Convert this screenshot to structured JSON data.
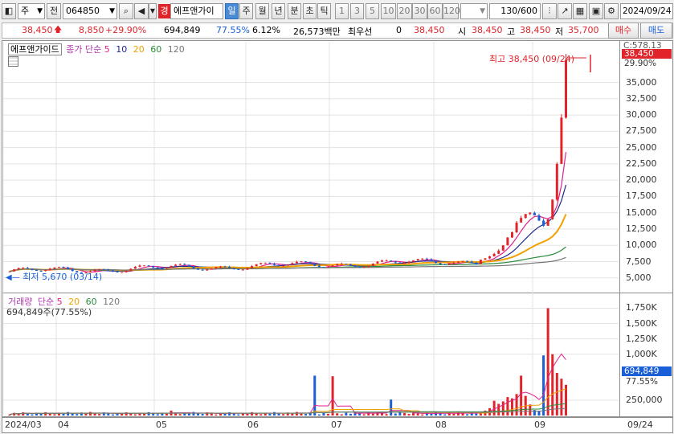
{
  "toolbar": {
    "market": "주",
    "series": "전",
    "code": "064850",
    "badge": "경",
    "name": "에프앤가이",
    "periods": [
      "일",
      "주",
      "월",
      "년",
      "분",
      "초",
      "틱"
    ],
    "active_period": "일",
    "intervals": [
      "1",
      "3",
      "5",
      "10",
      "20",
      "30",
      "60",
      "120"
    ],
    "count": "130",
    "count_total": "/600",
    "date": "2024/09/24"
  },
  "quote": {
    "price": "38,450",
    "arrow": "🡅",
    "change": "8,850",
    "change_pct": "+29.90%",
    "volume": "694,849",
    "turnover_pct": "77.55%",
    "ratio_pct": "6.12%",
    "amount": "26,573백만",
    "pref_label": "최우선",
    "pref_value": "0",
    "cur_price": "38,450",
    "open_label": "시",
    "open": "38,450",
    "high_label": "고",
    "high": "38,450",
    "low_label": "저",
    "low": "35,700",
    "buy_label": "매수",
    "sell_label": "매도"
  },
  "price_pane": {
    "legend_name": "에프앤가이드",
    "legend_ma": "종가 단순",
    "ma_periods": [
      "5",
      "10",
      "20",
      "60",
      "120"
    ],
    "ma_colors": [
      "#e0208a",
      "#1f2a8c",
      "#f0a000",
      "#2a8a3a",
      "#777777"
    ],
    "high_note": "최고 38,450 (09/24)",
    "low_note": "최저 5,670 (03/14)",
    "top_scale": "C:578.13",
    "current_tag": "38,450",
    "current_pct": "29.90%",
    "ticks": [
      "35,000",
      "32,500",
      "30,000",
      "27,500",
      "25,000",
      "22,500",
      "20,000",
      "17,500",
      "15,000",
      "12,500",
      "10,000",
      "7,500",
      "5,000"
    ]
  },
  "volume_pane": {
    "legend_name": "거래량",
    "legend_ma": "단순",
    "ma_periods": [
      "5",
      "20",
      "60",
      "120"
    ],
    "ma_colors": [
      "#e0208a",
      "#f0a000",
      "#2a8a3a",
      "#777777"
    ],
    "vol_note": "694,849주(77.55%)",
    "current_tag": "694,849",
    "current_pct": "77.55%",
    "ticks": [
      "1,750K",
      "1,500K",
      "1,250K",
      "1,000K",
      "250,000"
    ]
  },
  "x_axis": {
    "labels": [
      "2024/03",
      "04",
      "05",
      "06",
      "07",
      "08",
      "09"
    ],
    "right_label": "09/24"
  },
  "colors": {
    "up": "#e0242a",
    "down": "#1a5fd8",
    "active": "#4a8ad4"
  }
}
